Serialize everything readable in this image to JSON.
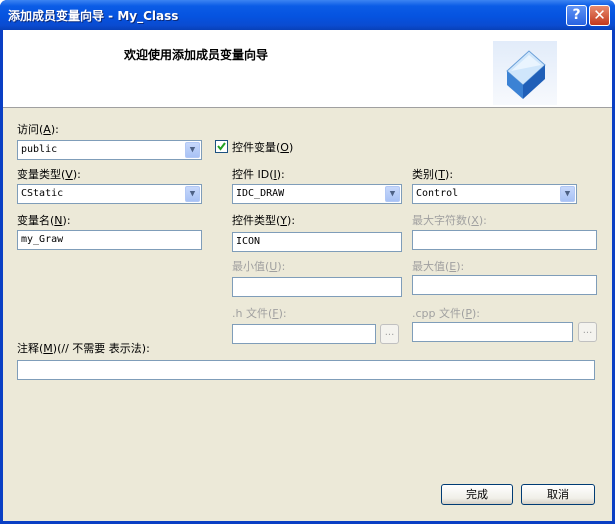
{
  "window": {
    "title": "添加成员变量向导 - My_Class",
    "help_label": "?",
    "close_label": "✕"
  },
  "header": {
    "title": "欢迎使用添加成员变量向导"
  },
  "form": {
    "access": {
      "label_pre": "访问(",
      "key": "A",
      "label_post": "):",
      "value": "public"
    },
    "control_var": {
      "label_pre": "控件变量(",
      "key": "O",
      "label_post": ")",
      "checked": true
    },
    "var_type": {
      "label_pre": "变量类型(",
      "key": "V",
      "label_post": "):",
      "value": "CStatic"
    },
    "control_id": {
      "label_pre": "控件 ID(",
      "key": "I",
      "label_post": "):",
      "value": "IDC_DRAW"
    },
    "category": {
      "label_pre": "类别(",
      "key": "T",
      "label_post": "):",
      "value": "Control"
    },
    "var_name": {
      "label_pre": "变量名(",
      "key": "N",
      "label_post": "):",
      "value": "my_Graw"
    },
    "control_type": {
      "label_pre": "控件类型(",
      "key": "Y",
      "label_post": "):",
      "value": "ICON"
    },
    "max_chars": {
      "label_pre": "最大字符数(",
      "key": "X",
      "label_post": "):",
      "value": ""
    },
    "min_value": {
      "label_pre": "最小值(",
      "key": "U",
      "label_post": "):",
      "value": ""
    },
    "max_value": {
      "label_pre": "最大值(",
      "key": "E",
      "label_post": "):",
      "value": ""
    },
    "h_file": {
      "label_pre": ".h 文件(",
      "key": "F",
      "label_post": "):",
      "value": "",
      "browse_label": "..."
    },
    "cpp_file": {
      "label_pre": ".cpp 文件(",
      "key": "P",
      "label_post": "):",
      "value": "",
      "browse_label": "..."
    },
    "comment": {
      "label_pre": "注释(",
      "key": "M",
      "label_post": ")(// 不需要 表示法):",
      "value": ""
    }
  },
  "buttons": {
    "finish": "完成",
    "cancel": "取消"
  },
  "colors": {
    "titlebar": "#0553e0",
    "dialog_bg": "#ece9d8",
    "accent_border": "#7f9db9"
  }
}
